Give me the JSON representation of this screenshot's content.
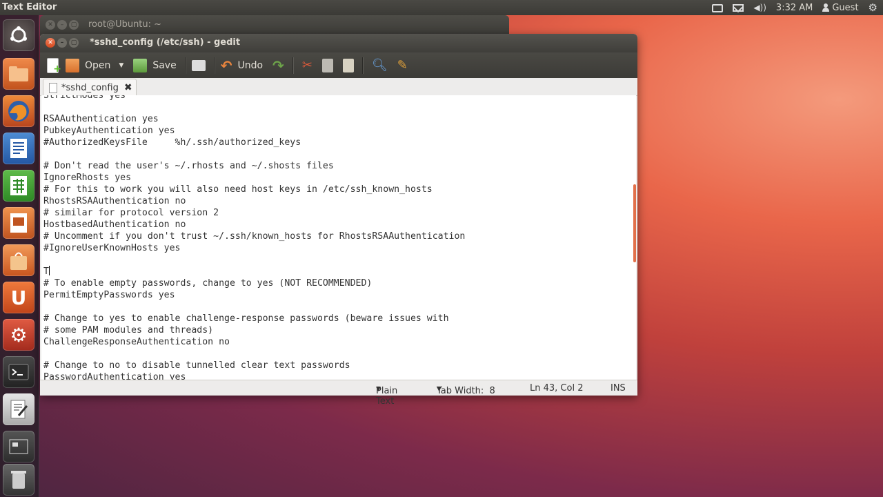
{
  "top_panel": {
    "app_name": "Text Editor",
    "clock": "3:32 AM",
    "user": "Guest",
    "icons": [
      "printer-icon",
      "mail-icon",
      "volume-icon",
      "user-icon",
      "session-gear-icon"
    ]
  },
  "launcher": {
    "items": [
      "ubuntu-dash",
      "files",
      "firefox",
      "libreoffice-writer",
      "libreoffice-calc",
      "libreoffice-impress",
      "software-center",
      "ubuntu-one",
      "system-settings",
      "terminal",
      "gedit",
      "workspace-switcher",
      "trash"
    ]
  },
  "terminal_window": {
    "title": "root@Ubuntu: ~"
  },
  "gedit": {
    "title": "*sshd_config (/etc/ssh) - gedit",
    "toolbar": {
      "open": "Open",
      "save": "Save",
      "undo": "Undo"
    },
    "tab": {
      "label": "*sshd_config"
    },
    "lines": [
      "StrictModes yes",
      "",
      "RSAAuthentication yes",
      "PubkeyAuthentication yes",
      "#AuthorizedKeysFile     %h/.ssh/authorized_keys",
      "",
      "# Don't read the user's ~/.rhosts and ~/.shosts files",
      "IgnoreRhosts yes",
      "# For this to work you will also need host keys in /etc/ssh_known_hosts",
      "RhostsRSAAuthentication no",
      "# similar for protocol version 2",
      "HostbasedAuthentication no",
      "# Uncomment if you don't trust ~/.ssh/known_hosts for RhostsRSAAuthentication",
      "#IgnoreUserKnownHosts yes",
      "",
      "T",
      "# To enable empty passwords, change to yes (NOT RECOMMENDED)",
      "PermitEmptyPasswords yes",
      "",
      "# Change to yes to enable challenge-response passwords (beware issues with",
      "# some PAM modules and threads)",
      "ChallengeResponseAuthentication no",
      "",
      "# Change to no to disable tunnelled clear text passwords",
      "PasswordAuthentication yes"
    ],
    "status": {
      "language": "Plain Text",
      "tab_width": "Tab Width:  8",
      "position": "Ln 43, Col 2",
      "mode": "INS"
    }
  }
}
